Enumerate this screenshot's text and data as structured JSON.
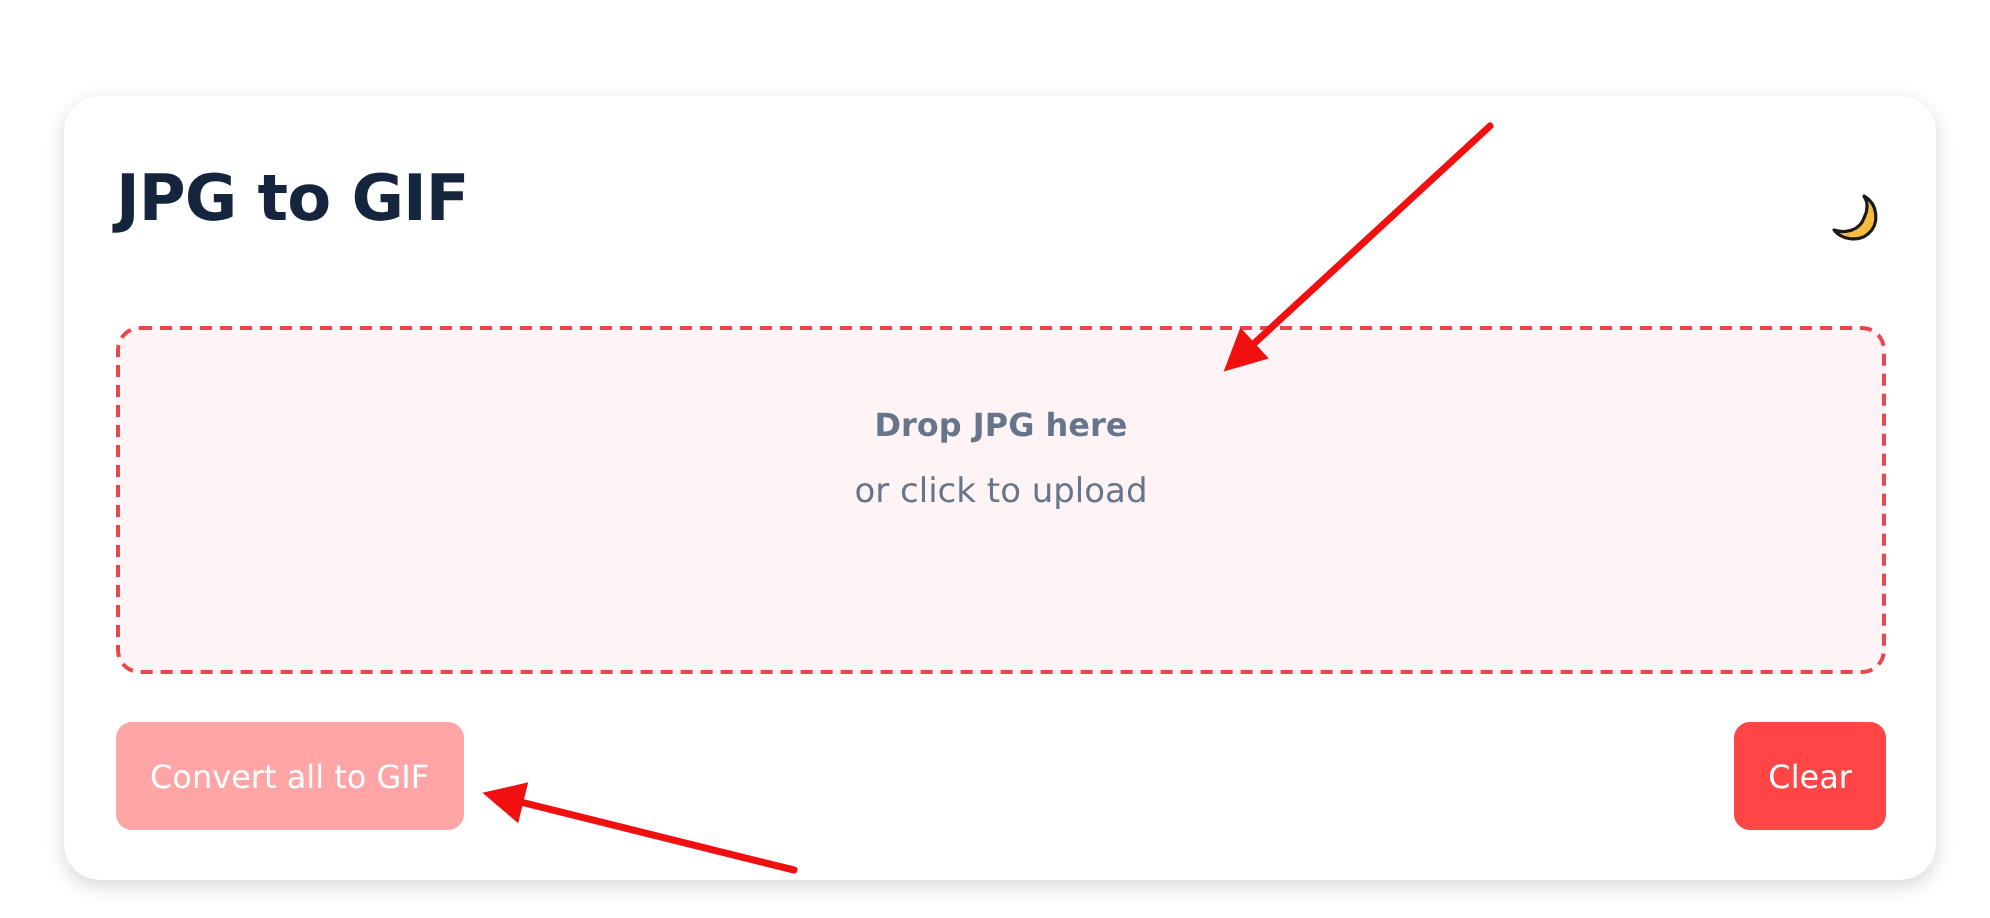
{
  "title": "JPG to GIF",
  "dropzone": {
    "heading": "Drop JPG here",
    "subtext": "or click to upload"
  },
  "buttons": [
    {
      "label": "Convert all to GIF",
      "disabled": true
    },
    {
      "label": "Clear",
      "disabled": false
    }
  ]
}
